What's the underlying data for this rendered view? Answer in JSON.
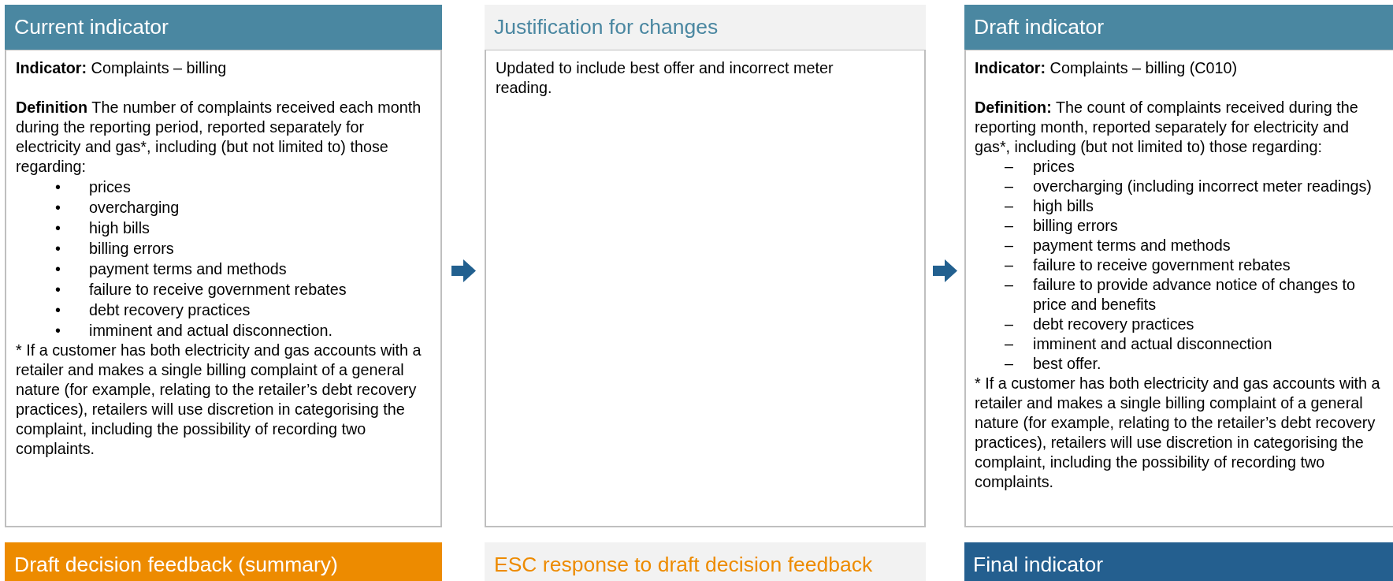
{
  "top_panels": [
    {
      "title": "Current indicator",
      "blocks": [
        {
          "kind": "lead",
          "text": "**Indicator:** Complaints – billing"
        },
        {
          "kind": "paragraph",
          "text": "**Definition** The number of complaints received each month during the reporting period, reported separately for electricity and gas*, including (but not limited to) those regarding:"
        },
        {
          "kind": "list",
          "items": [
            {
              "marker": "•",
              "text": "prices"
            },
            {
              "marker": "•",
              "text": "overcharging"
            },
            {
              "marker": "•",
              "text": "high bills"
            },
            {
              "marker": "•",
              "text": "billing errors"
            },
            {
              "marker": "•",
              "text": "payment terms and methods"
            },
            {
              "marker": "•",
              "text": "failure to receive government rebates"
            },
            {
              "marker": "•",
              "text": "debt recovery practices"
            },
            {
              "marker": "•",
              "text": "imminent and actual disconnection."
            }
          ]
        },
        {
          "kind": "paragraph",
          "text": "* If a customer has both electricity and gas accounts with a retailer and makes a single billing complaint of a general nature (for example, relating to the retailer’s debt recovery practices), retailers will use discretion in categorising the complaint, including the possibility of recording two complaints."
        }
      ]
    },
    {
      "title": "Justification for changes",
      "blocks": [
        {
          "kind": "paragraph",
          "text": "Updated to include best offer and incorrect meter reading."
        }
      ]
    },
    {
      "title": "Draft indicator",
      "blocks": [
        {
          "kind": "lead",
          "text": "**Indicator:** Complaints – billing (C010)"
        },
        {
          "kind": "paragraph",
          "text": "**Definition:** The count of complaints received during the reporting month, reported separately for electricity and gas*, including (but not limited to) those regarding:"
        },
        {
          "kind": "list",
          "items": [
            {
              "marker": "–",
              "text": "prices"
            },
            {
              "marker": "–",
              "text": "overcharging (including incorrect meter readings)"
            },
            {
              "marker": "–",
              "text": "high bills"
            },
            {
              "marker": "–",
              "text": "billing errors"
            },
            {
              "marker": "–",
              "text": "payment terms and methods"
            },
            {
              "marker": "–",
              "text": "failure to receive government rebates"
            },
            {
              "marker": "–",
              "text": "failure to provide advance notice of changes to price and benefits"
            },
            {
              "marker": "–",
              "text": "debt recovery practices"
            },
            {
              "marker": "–",
              "text": "imminent and actual disconnection"
            },
            {
              "marker": "–",
              "text": "best offer."
            }
          ]
        },
        {
          "kind": "paragraph",
          "text": "* If a customer has both electricity and gas accounts with a retailer and makes a single billing complaint of a general nature (for example, relating to the retailer’s debt recovery practices), retailers will use discretion in categorising the complaint, including the possibility of recording two complaints."
        }
      ]
    }
  ],
  "bottom_headers": [
    {
      "title": "Draft decision feedback (summary)"
    },
    {
      "title": "ESC response to draft decision feedback"
    },
    {
      "title": "Final indicator"
    }
  ]
}
